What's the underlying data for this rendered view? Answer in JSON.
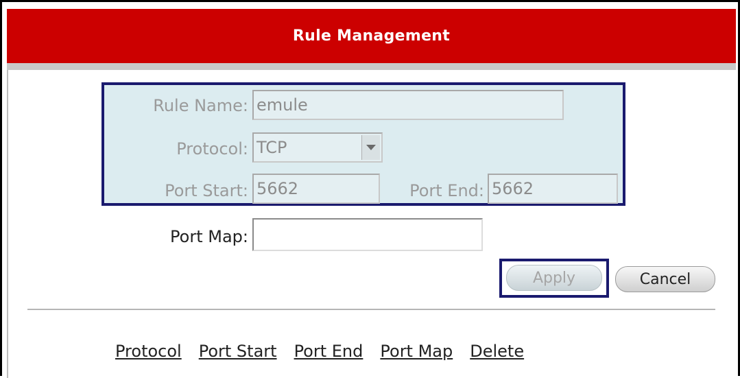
{
  "header": {
    "title": "Rule Management"
  },
  "form": {
    "rule_name": {
      "label": "Rule Name:",
      "value": "emule"
    },
    "protocol": {
      "label": "Protocol:",
      "value": "TCP"
    },
    "port_start": {
      "label": "Port Start:",
      "value": "5662"
    },
    "port_end": {
      "label": "Port End:",
      "value": "5662"
    },
    "port_map": {
      "label": "Port Map:",
      "value": ""
    }
  },
  "buttons": {
    "apply": "Apply",
    "cancel": "Cancel"
  },
  "links": [
    "Protocol",
    "Port Start",
    "Port End",
    "Port Map",
    "Delete"
  ],
  "colors": {
    "header": "#cc0000",
    "highlight_border": "#1a1a6e",
    "highlight_fill": "#dcecf0"
  },
  "icons": {
    "protocol_dropdown": "chevron-down-icon"
  }
}
